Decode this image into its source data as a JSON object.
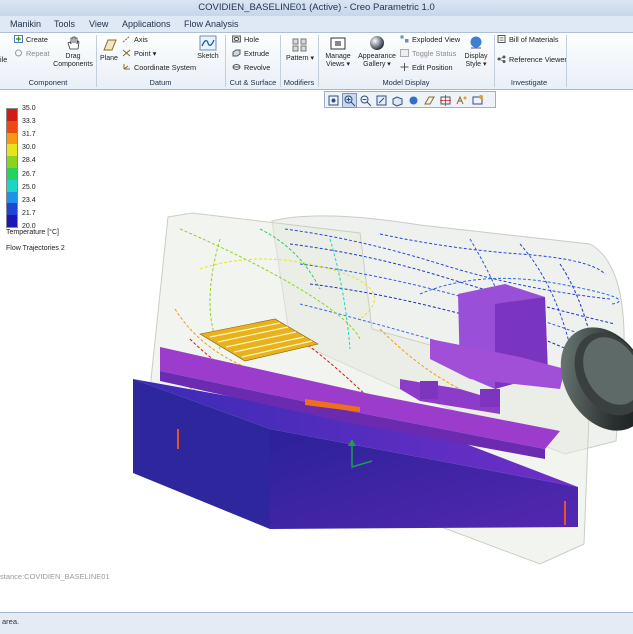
{
  "window": {
    "title": "COVIDIEN_BASELINE01 (Active) - Creo Parametric 1.0"
  },
  "menu_tabs": [
    "Manikin",
    "Tools",
    "View",
    "Applications",
    "Flow Analysis"
  ],
  "ribbon": {
    "component": {
      "create": "Create",
      "repeat": "Repeat",
      "cut_left": "ile",
      "drag_line1": "Drag",
      "drag_line2": "Components",
      "label": "Component"
    },
    "datum": {
      "plane": "Plane",
      "axis": "Axis",
      "point": "Point",
      "coord": "Coordinate System",
      "sketch": "Sketch",
      "label": "Datum"
    },
    "cut_surface": {
      "hole": "Hole",
      "extrude": "Extrude",
      "revolve": "Revolve",
      "label": "Cut & Surface"
    },
    "modifiers": {
      "pattern": "Pattern",
      "label": "Modifiers"
    },
    "model_display": {
      "manage_line1": "Manage",
      "manage_line2": "Views",
      "appearance_line1": "Appearance",
      "appearance_line2": "Gallery",
      "exploded": "Exploded View",
      "toggle": "Toggle Status",
      "edit_position": "Edit Position",
      "display_line1": "Display",
      "display_line2": "Style",
      "label": "Model Display"
    },
    "investigate": {
      "bom": "Bill of Materials",
      "refviewer": "Reference Viewer",
      "label": "Investigate"
    }
  },
  "view_toolbar_icons": [
    "refit-icon",
    "zoom-in-icon",
    "zoom-out-icon",
    "repaint-icon",
    "saved-orientations-icon",
    "display-style-icon",
    "datum-display-icon",
    "spin-center-icon",
    "annotation-display-icon",
    "view-manager-icon"
  ],
  "legend": {
    "values": [
      "35.0",
      "33.3",
      "31.7",
      "30.0",
      "28.4",
      "26.7",
      "25.0",
      "23.4",
      "21.7",
      "20.0"
    ],
    "colors": [
      "#d41a14",
      "#ee4a10",
      "#f79a12",
      "#e7e41c",
      "#8bd41e",
      "#27d261",
      "#19d6c5",
      "#1d92e8",
      "#1f45d8",
      "#1b16b8"
    ],
    "title": "Temperature [°C]",
    "trajectories": "Flow Trajectories 2"
  },
  "watermark": "stance:COVIDIEN_BASELINE01",
  "status": "area."
}
